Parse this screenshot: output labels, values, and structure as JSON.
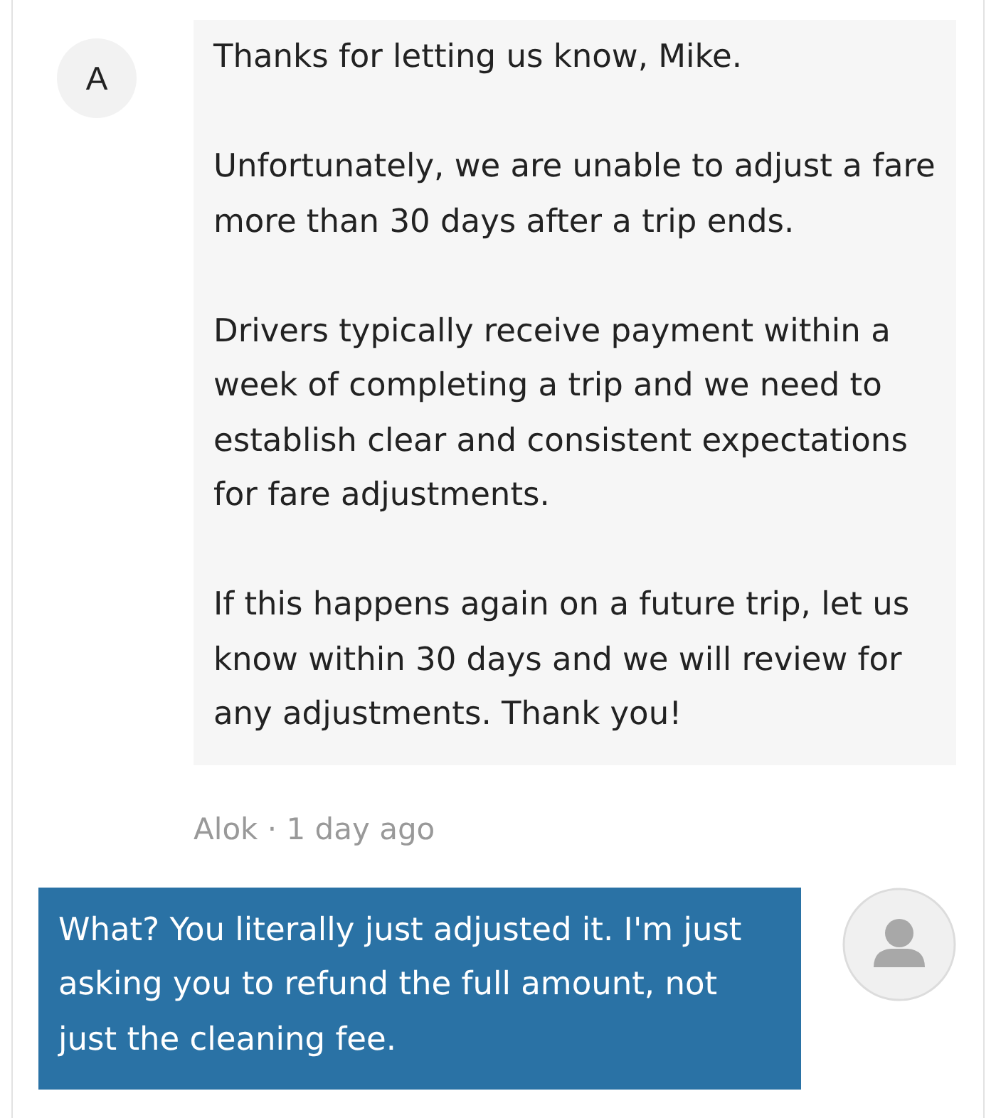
{
  "messages": [
    {
      "kind": "incoming",
      "avatar_letter": "A",
      "paragraphs": [
        "Thanks for letting us know, Mike.",
        "Unfortunately, we are unable to adjust a fare more than 30 days after a trip ends.",
        "Drivers typically receive payment within a week of completing a trip and we need to establish clear and consistent expectations for fare adjustments.",
        "If this happens again on a future trip, let us know within 30 days and we will review for any adjustments. Thank you!"
      ],
      "meta": "Alok · 1 day ago"
    },
    {
      "kind": "outgoing",
      "paragraphs": [
        "What? You literally just adjusted it. I'm just asking you to refund the full amount, not just the cleaning fee."
      ]
    }
  ]
}
